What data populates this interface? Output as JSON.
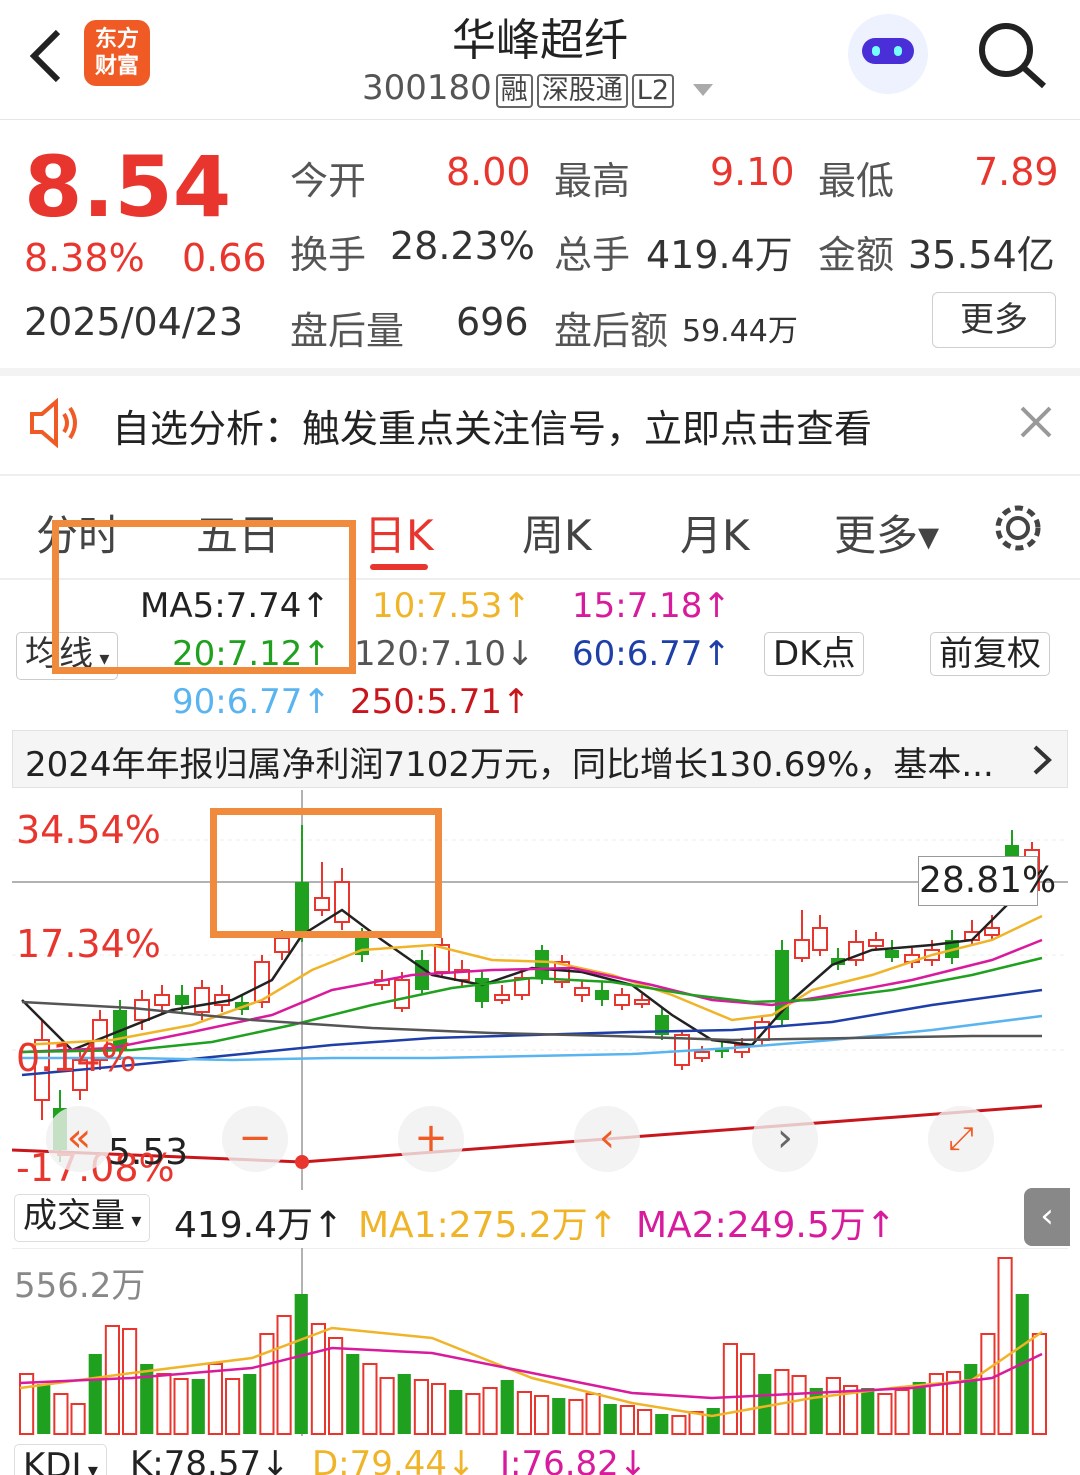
{
  "header": {
    "stock_name": "华峰超纤",
    "stock_code": "300180",
    "tags": [
      "融",
      "深股通",
      "L2"
    ],
    "logo_text": [
      "东方",
      "财富"
    ],
    "back_icon": "chevron-left-icon",
    "search_icon": "search-icon",
    "avatar_icon": "robot-avatar-icon"
  },
  "quote": {
    "price": "8.54",
    "change_pct": "8.38%",
    "change_amt": "0.66",
    "date": "2025/04/23",
    "open_label": "今开",
    "open": "8.00",
    "high_label": "最高",
    "high": "9.10",
    "low_label": "最低",
    "low": "7.89",
    "turnover_label": "换手",
    "turnover": "28.23%",
    "volume_label": "总手",
    "volume": "419.4万",
    "amount_label": "金额",
    "amount": "35.54亿",
    "after_vol_label": "盘后量",
    "after_vol": "696",
    "after_amt_label": "盘后额",
    "after_amt": "59.44万",
    "more_label": "更多"
  },
  "notice": {
    "text": "自选分析：触发重点关注信号，立即点击查看",
    "icon": "speaker-icon",
    "close_icon": "close-icon"
  },
  "tabs": [
    {
      "label": "分时"
    },
    {
      "label": "五日"
    },
    {
      "label": "日K"
    },
    {
      "label": "周K"
    },
    {
      "label": "月K"
    },
    {
      "label": "更多▾"
    }
  ],
  "ma": {
    "selector": "均线",
    "ma5": "MA5:7.74↑",
    "ma10": "10:7.53↑",
    "ma15": "15:7.18↑",
    "ma20": "20:7.12↑",
    "ma120": "120:7.10↓",
    "ma60": "60:6.77↑",
    "ma90": "90:6.77↑",
    "ma250": "250:5.71↑",
    "dk_label": "DK点",
    "fq_label": "前复权"
  },
  "news_banner": "2024年年报归属净利润7102万元，同比增长130.69%，基本...",
  "kchart": {
    "y_top": "34.54%",
    "y_mid": "17.34%",
    "y_low": "0.14%",
    "y_bottom": "-17.08%",
    "low_mark": "5.53",
    "cursor_label": "28.81%"
  },
  "volume": {
    "selector": "成交量",
    "value": "419.4万↑",
    "ma1": "MA1:275.2万↑",
    "ma2": "MA2:249.5万↑",
    "max_label": "556.2万"
  },
  "kdj": {
    "selector": "KDJ",
    "k": "K:78.57↓",
    "d": "D:79.44↓",
    "j": "J:76.82↓"
  },
  "colors": {
    "up": "#e8362f",
    "down": "#1fa11f",
    "accent": "#f05a24",
    "highlight": "#f08a3c"
  }
}
